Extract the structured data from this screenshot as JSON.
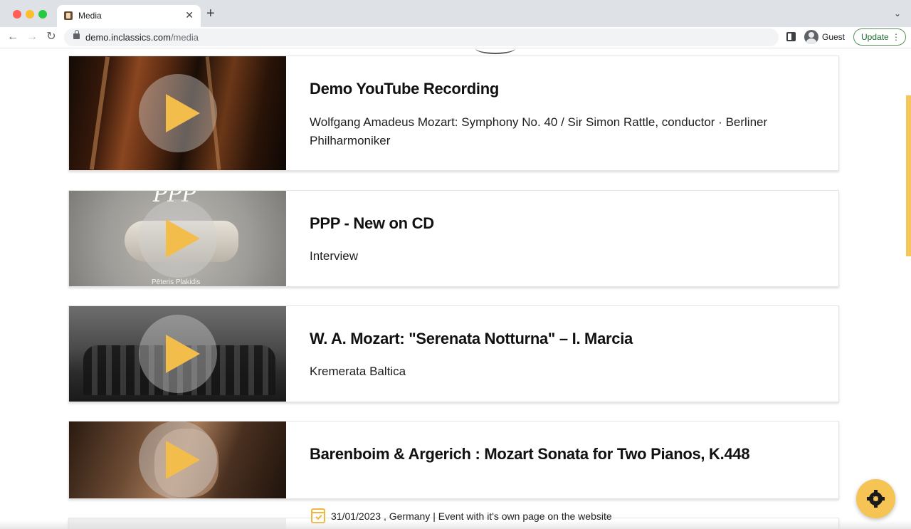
{
  "browser": {
    "tab_title": "Media",
    "tab_close": "✕",
    "new_tab": "+",
    "tab_menu": "⌄",
    "url_host": "demo.inclassics.com",
    "url_path": "/media",
    "profile_label": "Guest",
    "update_label": "Update",
    "nav": {
      "back": "←",
      "forward": "→",
      "reload": "↻"
    }
  },
  "cards": [
    {
      "title": "Demo YouTube Recording",
      "subtitle": "Wolfgang Amadeus Mozart: Symphony No. 40 / Sir Simon Rattle, conductor · Berliner Philharmoniker"
    },
    {
      "title": "PPP - New on CD",
      "subtitle": "Interview",
      "thumb_text": "PPP",
      "thumb_caption": "Pēteris  Plakidis"
    },
    {
      "title": "W. A. Mozart: \"Serenata Notturna\" – I. Marcia",
      "subtitle": "Kremerata Baltica"
    },
    {
      "title": "Barenboim & Argerich : Mozart Sonata for Two Pianos, K.448",
      "subtitle": ""
    }
  ],
  "event": {
    "text": "31/01/2023 , Germany | Event with it's own page on the website"
  },
  "colors": {
    "accent": "#f3bd4c",
    "fab": "#f5c455",
    "update_border": "#5a8f5a"
  }
}
